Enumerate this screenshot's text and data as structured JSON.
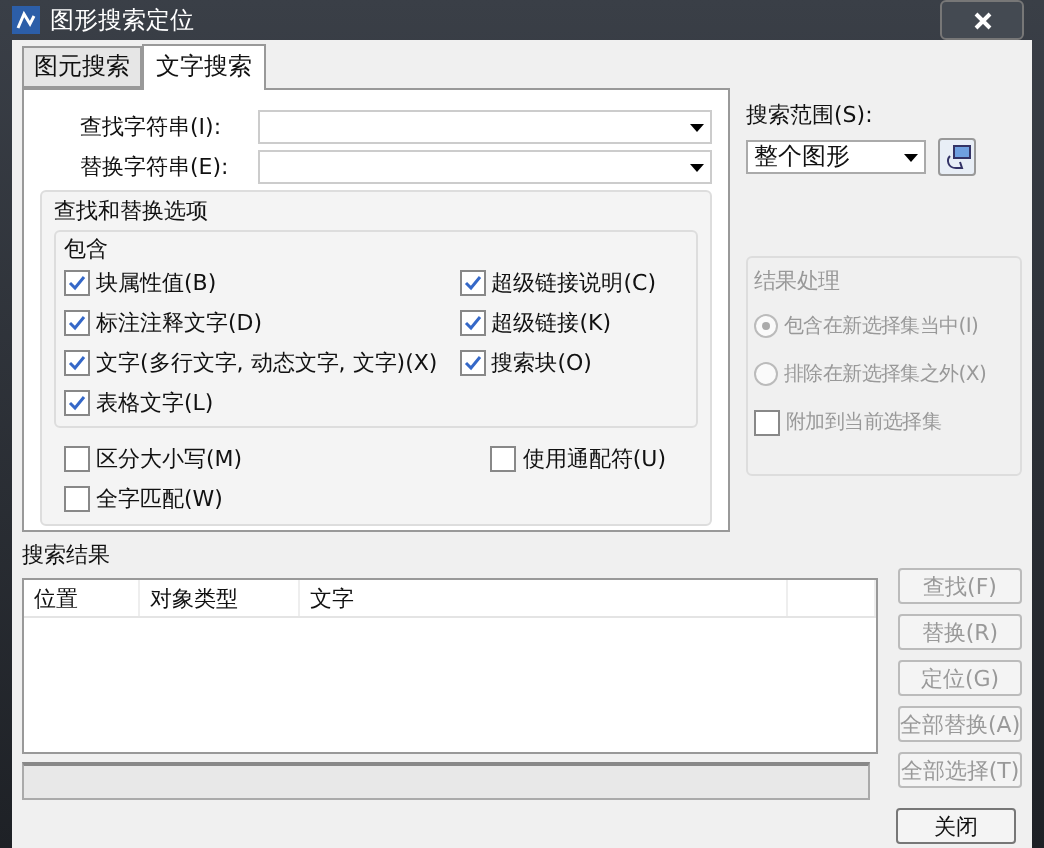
{
  "window": {
    "title": "图形搜索定位"
  },
  "tabs": [
    {
      "label": "图元搜索",
      "selected": false
    },
    {
      "label": "文字搜索",
      "selected": true
    }
  ],
  "fields": [
    {
      "label": "查找字符串(I):"
    },
    {
      "label": "替换字符串(E):"
    }
  ],
  "options": {
    "title": "查找和替换选项",
    "include_title": "包含",
    "include_left": [
      {
        "label": "块属性值(B)",
        "checked": true
      },
      {
        "label": "标注注释文字(D)",
        "checked": true
      },
      {
        "label": "文字(多行文字, 动态文字, 文字)(X)",
        "checked": true
      },
      {
        "label": "表格文字(L)",
        "checked": true
      }
    ],
    "include_right": [
      {
        "label": "超级链接说明(C)",
        "checked": true
      },
      {
        "label": "超级链接(K)",
        "checked": true
      },
      {
        "label": "搜索块(O)",
        "checked": true
      }
    ],
    "other_left": [
      {
        "label": "区分大小写(M)",
        "checked": false
      },
      {
        "label": "全字匹配(W)",
        "checked": false
      }
    ],
    "other_right": [
      {
        "label": "使用通配符(U)",
        "checked": false
      }
    ]
  },
  "scope": {
    "label": "搜索范围(S):",
    "value": "整个图形"
  },
  "result_handling": {
    "title": "结果处理",
    "disabled": true,
    "radios": [
      {
        "label": "包含在新选择集当中(I)",
        "selected": true
      },
      {
        "label": "排除在新选择集之外(X)",
        "selected": false
      }
    ],
    "checkbox": {
      "label": "附加到当前选择集",
      "checked": false
    }
  },
  "results": {
    "title": "搜索结果",
    "columns": [
      "位置",
      "对象类型",
      "文字"
    ]
  },
  "actions": [
    {
      "label": "查找(F)",
      "disabled": true
    },
    {
      "label": "替换(R)",
      "disabled": true
    },
    {
      "label": "定位(G)",
      "disabled": true
    },
    {
      "label": "全部替换(A)",
      "disabled": true
    },
    {
      "label": "全部选择(T)",
      "disabled": true
    }
  ],
  "close_button": {
    "label": "关闭"
  }
}
